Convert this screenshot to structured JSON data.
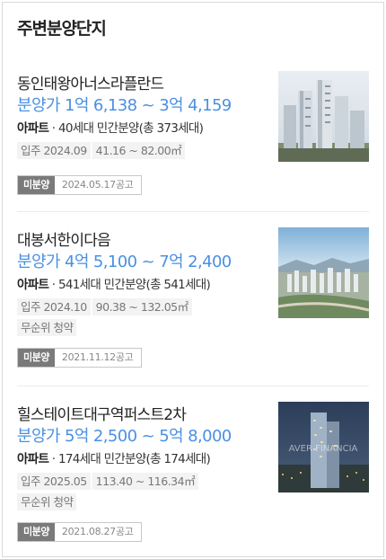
{
  "section": {
    "title": "주변분양단지"
  },
  "complexes": [
    {
      "name": "동인태왕아너스라플란드",
      "price": "분양가 1억 6,138 ~ 3억 4,159",
      "kind": "아파트",
      "supply": " · 40세대 민간분양(총 373세대)",
      "tags": [
        "입주 2024.09",
        "41.16 ~ 82.00㎡"
      ],
      "status_badge": "미분양",
      "notice_date": "2024.05.17공고",
      "image": "apartment-towers-photo"
    },
    {
      "name": "대봉서한이다음",
      "price": "분양가 4억 5,100 ~ 7억 2,400",
      "kind": "아파트",
      "supply": " · 541세대 민간분양(총 541세대)",
      "tags": [
        "입주 2024.10",
        "90.38 ~ 132.05㎡",
        "무순위 청약"
      ],
      "status_badge": "미분양",
      "notice_date": "2021.11.12공고",
      "image": "city-aerial-photo"
    },
    {
      "name": "힐스테이트대구역퍼스트2차",
      "price": "분양가 5억 2,500 ~ 5억 8,000",
      "kind": "아파트",
      "supply": " · 174세대 민간분양(총 174세대)",
      "tags": [
        "입주 2025.05",
        "113.40 ~ 116.34㎡",
        "무순위 청약"
      ],
      "status_badge": "미분양",
      "notice_date": "2021.08.27공고",
      "image": "night-tower-photo",
      "image_watermark": "AVER FINANCIA"
    }
  ]
}
